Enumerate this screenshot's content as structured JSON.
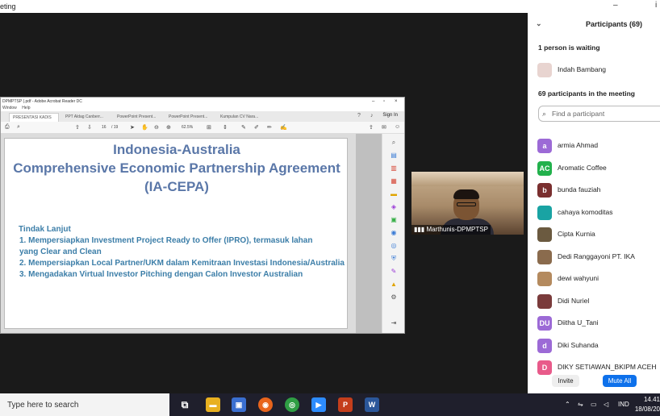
{
  "window": {
    "title": "eting",
    "min_glyph": "–",
    "max_glyph": "i"
  },
  "acrobat": {
    "title": "DPMPTSP (.pdf - Adobe Acrobat Reader DC",
    "menu": [
      "Window",
      "Help"
    ],
    "tabs": [
      "PRESENTASI KADIS ...",
      "PPT Aldag Canberr...",
      "PowerPoint Present...",
      "PowerPoint Present...",
      "Kumpulan CV Nara..."
    ],
    "sign_in": "Sign In",
    "page_current": "16",
    "page_total": "/ 19",
    "zoom": "62.5%"
  },
  "slide": {
    "title_line1": "Indonesia-Australia",
    "title_line2": "Comprehensive Economic Partnership Agreement",
    "title_line3": "(IA-CEPA)",
    "subtitle": "Tindak Lanjut",
    "items": [
      "1.   Mempersiapkan Investment Project Ready to Offer (IPRO), termasuk lahan",
      "       yang Clear and Clean",
      "2.   Mempersiapkan Local Partner/UKM dalam Kemitraan Investasi Indonesia/Australia",
      "3.   Mengadakan Virtual Investor Pitching dengan Calon Investor Australian"
    ]
  },
  "video": {
    "name": "Marthunis-DPMPTSP"
  },
  "participants": {
    "header": "Participants (69)",
    "waiting_label": "1 person is waiting",
    "waiting_name": "Indah Bambang",
    "in_meeting_label": "69 participants in the meeting",
    "search_placeholder": "Find a participant",
    "list": [
      {
        "initial": "a",
        "name": "armia Ahmad",
        "color": "#9c6ad6"
      },
      {
        "initial": "AC",
        "name": "Aromatic Coffee",
        "color": "#22b14c"
      },
      {
        "initial": "b",
        "name": "bunda fauziah",
        "color": "#7a2f2f"
      },
      {
        "initial": "",
        "name": "cahaya komoditas",
        "color": "#19a3a3"
      },
      {
        "initial": "",
        "name": "Cipta Kurnia",
        "color": "#6b5a40"
      },
      {
        "initial": "",
        "name": "Dedi Ranggayoni PT. IKA",
        "color": "#8a6b4d"
      },
      {
        "initial": "",
        "name": "dewi wahyuni",
        "color": "#b48a5e"
      },
      {
        "initial": "",
        "name": "Didi Nuriel",
        "color": "#7a3b3b"
      },
      {
        "initial": "DU",
        "name": "Diitha U_Tani",
        "color": "#9c6ad6"
      },
      {
        "initial": "d",
        "name": "Diki Suhanda",
        "color": "#9c6ad6"
      },
      {
        "initial": "D",
        "name": "DIKY SETIAWAN_BKIPM ACEH",
        "color": "#e85a8a"
      }
    ],
    "invite": "Invite",
    "mute_all": "Mute All"
  },
  "taskbar": {
    "search": "Type here to search",
    "lang": "IND",
    "time": "14.41",
    "date": "18/08/20"
  }
}
